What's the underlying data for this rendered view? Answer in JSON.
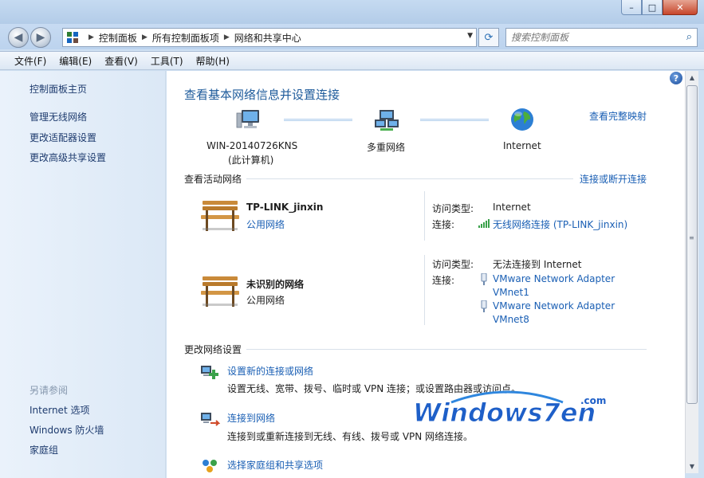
{
  "window": {
    "controls": {
      "minimize": "–",
      "maximize": "□",
      "close": "✕"
    }
  },
  "address": {
    "crumbs": [
      "控制面板",
      "所有控制面板项",
      "网络和共享中心"
    ],
    "search_placeholder": "搜索控制面板"
  },
  "menu": [
    "文件(F)",
    "编辑(E)",
    "查看(V)",
    "工具(T)",
    "帮助(H)"
  ],
  "sidebar": {
    "home": "控制面板主页",
    "links": [
      "管理无线网络",
      "更改适配器设置",
      "更改高级共享设置"
    ],
    "see_also_title": "另请参阅",
    "see_also": [
      "Internet 选项",
      "Windows 防火墙",
      "家庭组"
    ]
  },
  "main": {
    "title": "查看基本网络信息并设置连接",
    "full_map": "查看完整映射",
    "map": {
      "computer_name": "WIN-20140726KNS",
      "computer_sub": "(此计算机)",
      "multi_network": "多重网络",
      "internet": "Internet"
    },
    "active_networks_title": "查看活动网络",
    "connect_disconnect": "连接或断开连接",
    "networks": [
      {
        "name": "TP-LINK_jinxin",
        "type": "公用网络",
        "access_label": "访问类型:",
        "access_value": "Internet",
        "conn_label": "连接:",
        "connections": [
          "无线网络连接 (TP-LINK_jinxin)"
        ]
      },
      {
        "name": "未识别的网络",
        "type": "公用网络",
        "access_label": "访问类型:",
        "access_value": "无法连接到 Internet",
        "conn_label": "连接:",
        "connections": [
          "VMware Network Adapter",
          "VMnet1",
          "VMware Network Adapter",
          "VMnet8"
        ]
      }
    ],
    "change_settings_title": "更改网络设置",
    "tasks": [
      {
        "title": "设置新的连接或网络",
        "desc": "设置无线、宽带、拨号、临时或 VPN 连接；或设置路由器或访问点。"
      },
      {
        "title": "连接到网络",
        "desc": "连接到或重新连接到无线、有线、拨号或 VPN 网络连接。"
      },
      {
        "title": "选择家庭组和共享选项",
        "desc": ""
      }
    ]
  },
  "watermark": {
    "text": "Windows7en",
    "suffix": ".com"
  },
  "colors": {
    "link": "#1a5fb4",
    "title": "#1e5b9b",
    "accent": "#2a6fb5"
  }
}
